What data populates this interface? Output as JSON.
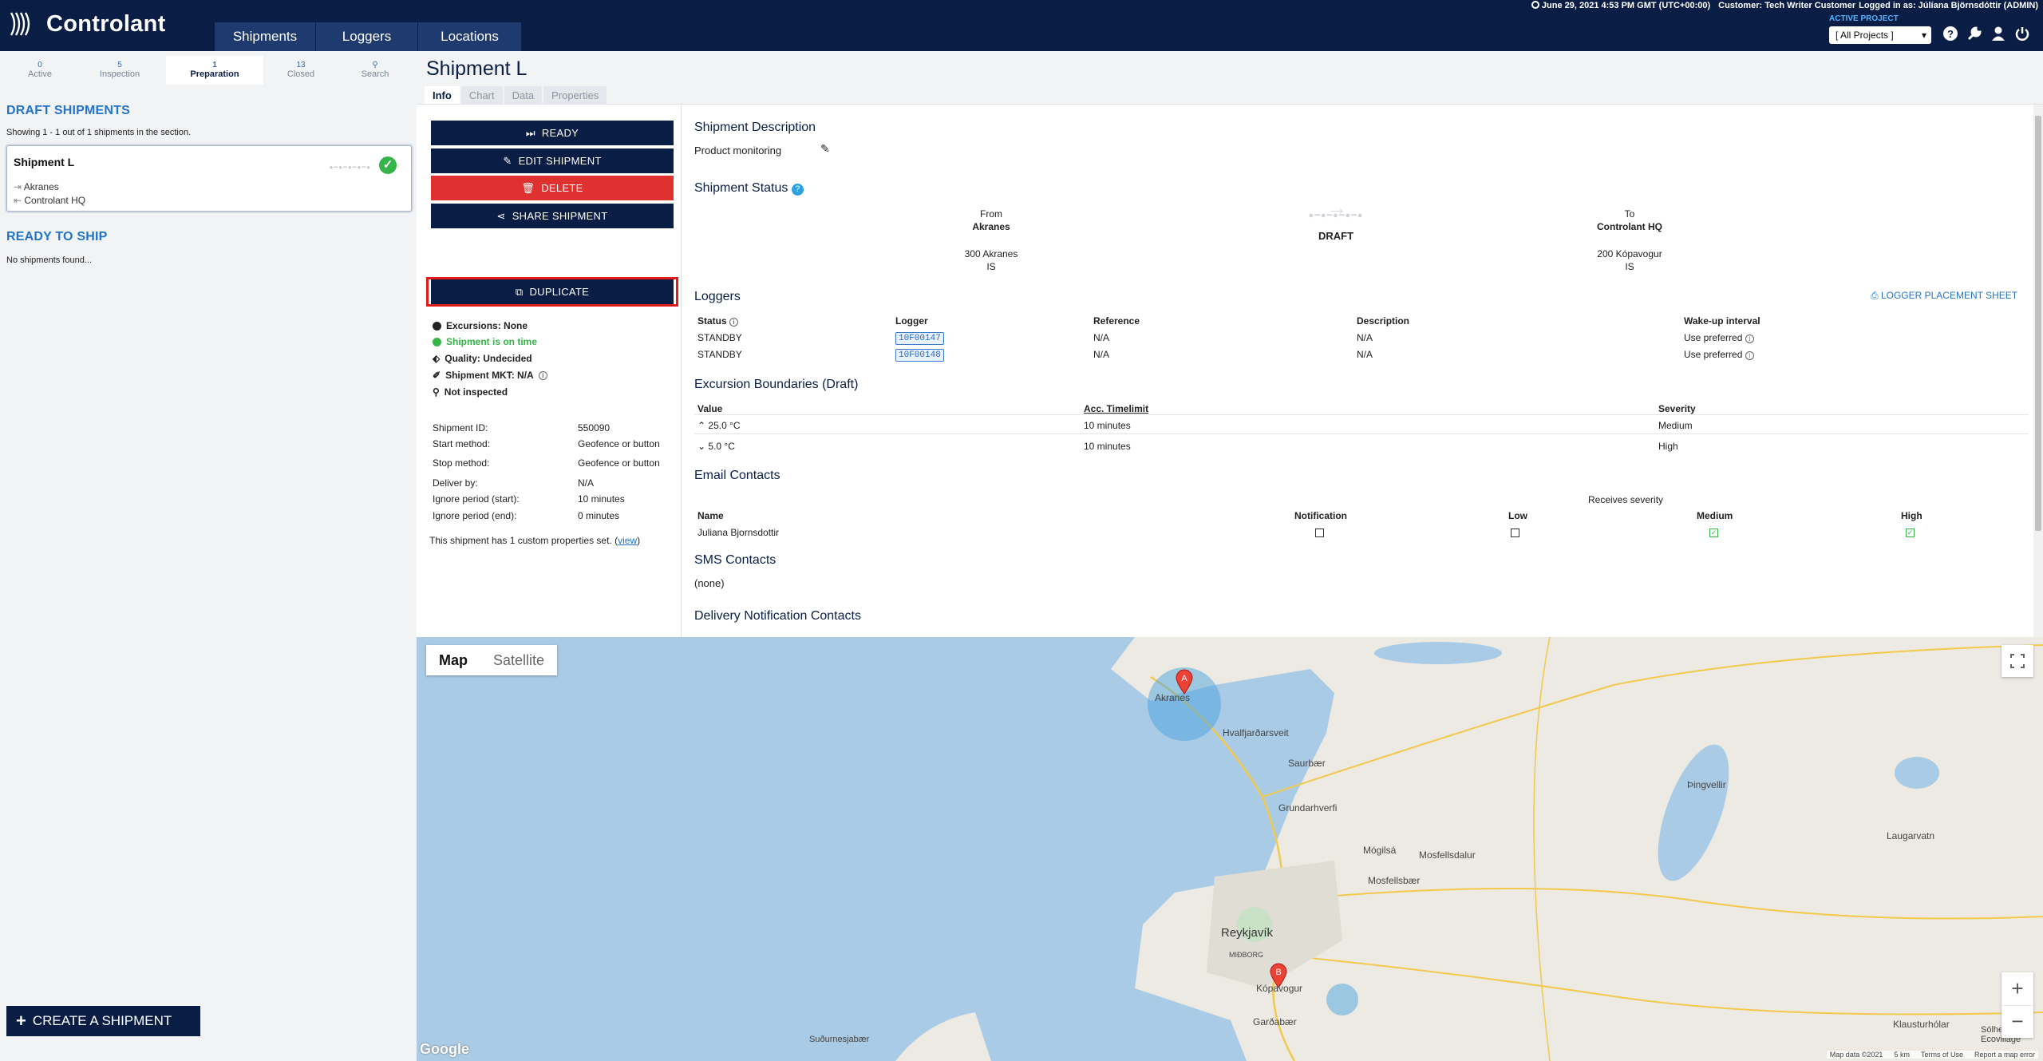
{
  "app": {
    "brand": "Controlant"
  },
  "nav": {
    "tabs": [
      "Shipments",
      "Loggers",
      "Locations"
    ]
  },
  "topbar": {
    "datetime": "June 29, 2021 4:53 PM GMT (UTC+00:00)",
    "customer": "Customer: Tech Writer Customer",
    "logged_in": "Logged in as: Júlíana Björnsdóttir (ADMIN)",
    "active_project_label": "ACTIVE PROJECT",
    "project_select": "[ All Projects ]"
  },
  "sidebar": {
    "tabs": [
      {
        "count": "0",
        "label": "Active"
      },
      {
        "count": "5",
        "label": "Inspection"
      },
      {
        "count": "1",
        "label": "Preparation"
      },
      {
        "count": "13",
        "label": "Closed"
      },
      {
        "count": "",
        "label": "Search"
      }
    ],
    "draft_heading": "DRAFT SHIPMENTS",
    "showing": "Showing 1 - 1 out of 1 shipments in the section.",
    "card": {
      "title": "Shipment L",
      "from": "Akranes",
      "to": "Controlant HQ"
    },
    "ready_heading": "READY TO SHIP",
    "no_shipments": "No shipments found...",
    "create_button": "CREATE A SHIPMENT"
  },
  "main": {
    "title": "Shipment L",
    "tabs": [
      "Info",
      "Chart",
      "Data",
      "Properties"
    ],
    "actions": {
      "ready": "READY",
      "edit": "EDIT SHIPMENT",
      "delete": "DELETE",
      "share": "SHARE SHIPMENT",
      "duplicate": "DUPLICATE"
    },
    "status_list": [
      "Excursions: None",
      "Shipment is on time",
      "Quality: Undecided",
      "Shipment MKT: N/A",
      "Not inspected"
    ],
    "details": [
      {
        "k": "Shipment ID:",
        "v": "550090"
      },
      {
        "k": "Start method:",
        "v": "Geofence or button"
      },
      {
        "k": "Stop method:",
        "v": "Geofence or button"
      },
      {
        "k": "Deliver by:",
        "v": "N/A"
      },
      {
        "k": "Ignore period (start):",
        "v": "10 minutes"
      },
      {
        "k": "Ignore period (end):",
        "v": "0 minutes"
      }
    ],
    "custom_props": "This shipment has 1 custom properties set. (",
    "custom_props_link": "view",
    "custom_props_end": ")",
    "desc_heading": "Shipment Description",
    "desc_value": "Product monitoring",
    "status_heading": "Shipment Status",
    "from_label": "From",
    "from_name": "Akranes",
    "from_addr": "300 Akranes",
    "from_country": "IS",
    "status_value": "DRAFT",
    "to_label": "To",
    "to_name": "Controlant HQ",
    "to_addr": "200 Kópavogur",
    "to_country": "IS",
    "loggers_heading": "Loggers",
    "logger_sheet": "LOGGER PLACEMENT SHEET",
    "logger_cols": [
      "Status",
      "Logger",
      "Reference",
      "Description",
      "Wake-up interval"
    ],
    "loggers": [
      {
        "status": "STANDBY",
        "logger": "10F00147",
        "ref": "N/A",
        "desc": "N/A",
        "wake": "Use preferred"
      },
      {
        "status": "STANDBY",
        "logger": "10F00148",
        "ref": "N/A",
        "desc": "N/A",
        "wake": "Use preferred"
      }
    ],
    "exc_heading": "Excursion Boundaries (Draft)",
    "exc_cols": [
      "Value",
      "Acc. Timelimit",
      "Severity"
    ],
    "exc_rows": [
      {
        "value": "25.0 °C",
        "time": "10 minutes",
        "sev": "Medium"
      },
      {
        "value": "5.0 °C",
        "time": "10 minutes",
        "sev": "High"
      }
    ],
    "email_heading": "Email Contacts",
    "receives_severity": "Receives severity",
    "email_cols": [
      "Name",
      "Notification",
      "Low",
      "Medium",
      "High"
    ],
    "email_name": "Juliana Bjornsdottir",
    "sms_heading": "SMS Contacts",
    "sms_value": "(none)",
    "delivery_heading": "Delivery Notification Contacts"
  },
  "map": {
    "type_map": "Map",
    "type_sat": "Satellite",
    "labels": {
      "akranes": "Akranes",
      "hvalfj": "Hvalfjarðarsveit",
      "saurbaer": "Saurbær",
      "grund": "Grundarhverfi",
      "mogilsa": "Mógilsá",
      "mosfellsdalur": "Mosfellsdalur",
      "mosfellsbaer": "Mosfellsbær",
      "reykjavik": "Reykjavík",
      "midborg": "MIÐBORG",
      "kopavogur": "Kópavogur",
      "gardabaer": "Garðabær",
      "thingvellir": "Þingvellir",
      "laugarvatn": "Laugarvatn",
      "klaustur": "Klausturhólar",
      "solhe": "Sólhe Ecovillage",
      "sudurnes": "Suðurnesjabær",
      "google": "Google"
    },
    "footer": [
      "Map data ©2021",
      "5 km",
      "Terms of Use",
      "Report a map error"
    ],
    "pin_a": "A",
    "pin_b": "B"
  }
}
